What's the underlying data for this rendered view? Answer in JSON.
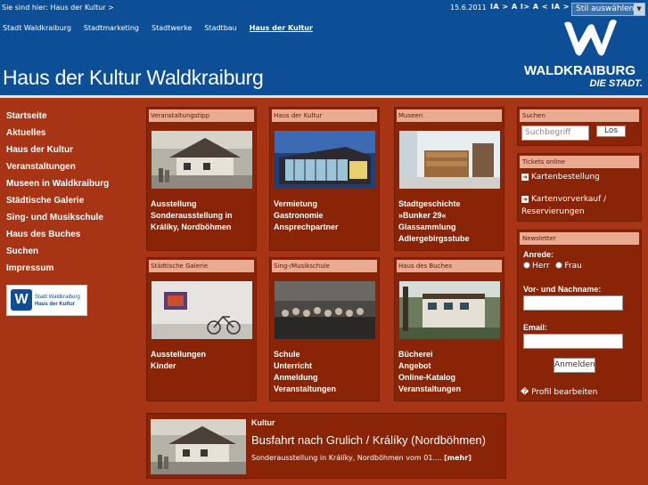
{
  "header": {
    "breadcrumb": "Sie sind hier: Haus der Kultur >",
    "date": "15.6.2011",
    "font_sizes": "IA > A I> A < IA > A",
    "style_select": "Stil auswählen",
    "site_title": "Haus der Kultur Waldkraiburg",
    "logo_name": "WALDKRAIBURG",
    "logo_tagline": "DIE STADT."
  },
  "topnav": [
    {
      "label": "Stadt Waldkraiburg",
      "active": false
    },
    {
      "label": "Stadtmarketing",
      "active": false
    },
    {
      "label": "Stadtwerke",
      "active": false
    },
    {
      "label": "Stadtbau",
      "active": false
    },
    {
      "label": "Haus der Kultur",
      "active": true
    }
  ],
  "leftnav": [
    "Startseite",
    "Aktuelles",
    "Haus der Kultur",
    "Veranstaltungen",
    "Museen in Waldkraiburg",
    "Städtische Galerie",
    "Sing- und Musikschule",
    "Haus des Buches",
    "Suchen",
    "Impressum"
  ],
  "side_logo": {
    "line1": "Stadt Waldkraiburg",
    "line2": "Haus der Kultur"
  },
  "tiles": [
    {
      "title": "Veranstaltungstipp",
      "image": "farmhouse-photo",
      "lines": [
        "Ausstellung",
        "Sonderausstellung in",
        "Králíky, Nordböhmen"
      ]
    },
    {
      "title": "Haus der Kultur",
      "image": "building-night-photo",
      "lines": [
        "Vermietung",
        "Gastronomie",
        "Ansprechpartner"
      ]
    },
    {
      "title": "Museen",
      "image": "museum-exhibit-photo",
      "lines": [
        "Stadtgeschichte",
        "»Bunker 29«",
        "Glassammlung",
        "Adlergebirgsstube"
      ]
    },
    {
      "title": "Städtische Galerie",
      "image": "gallery-bicycle-photo",
      "lines": [
        "Ausstellungen",
        "Kinder"
      ]
    },
    {
      "title": "Sing-/Musikschule",
      "image": "choir-photo",
      "lines": [
        "Schule",
        "Unterricht",
        "Anmeldung",
        "Veranstaltungen"
      ]
    },
    {
      "title": "Haus des Buches",
      "image": "library-building-photo",
      "lines": [
        "Bücherei",
        "Angebot",
        "Online-Katalog",
        "Veranstaltungen"
      ]
    }
  ],
  "search": {
    "title": "Suchen",
    "placeholder": "Suchbegriff",
    "button": "Los"
  },
  "tickets": {
    "title": "Tickets online",
    "link1": "Kartenbestellung",
    "link2a": "Kartenvorverkauf /",
    "link2b": "Reservierungen"
  },
  "newsletter": {
    "title": "Newsletter",
    "salutation_label": "Anrede:",
    "option_herr": "Herr",
    "option_frau": "Frau",
    "name_label": "Vor- und Nachname:",
    "email_label": "Email:",
    "submit": "Anmelden",
    "profile_link": "� Profil bearbeiten"
  },
  "news": {
    "category": "Kultur",
    "title": "Busfahrt nach Grulich / Králíky (Nordböhmen)",
    "text": "Sonderausstellung in Králíky, Nordböhmen vom 01....",
    "more": "[mehr]"
  },
  "colors": {
    "header_blue": "#0d4f96",
    "page_red": "#a83416",
    "tile_red": "#8a2407",
    "tile_header": "#e9ab91"
  }
}
